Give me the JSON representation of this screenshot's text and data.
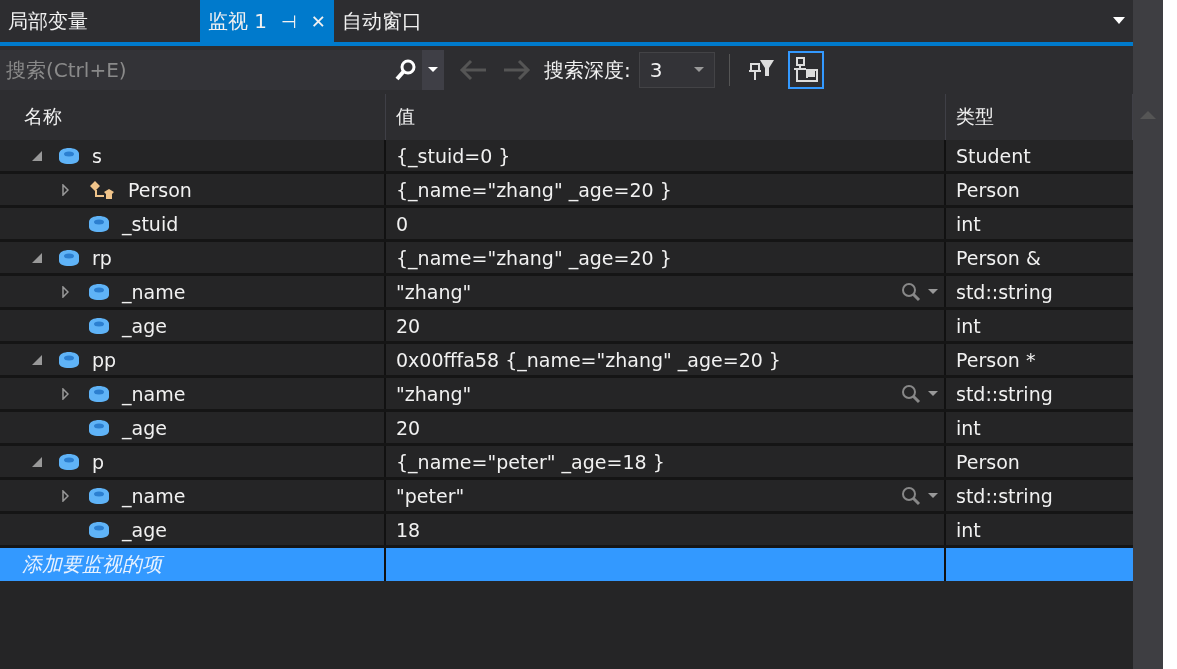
{
  "tabs": [
    {
      "label": "局部变量",
      "selected": false
    },
    {
      "label": "监视 1",
      "selected": true,
      "pin": "⊣",
      "close": "✕"
    },
    {
      "label": "自动窗口",
      "selected": false
    }
  ],
  "toolbar": {
    "search": {
      "placeholder": "搜索(Ctrl+E)"
    },
    "depth_label": "搜索深度:",
    "depth_value": "3",
    "filter_selected": false,
    "hex_selected": true
  },
  "columns": [
    "名称",
    "值",
    "类型"
  ],
  "variables": [
    {
      "name": "s",
      "kind": "field",
      "value": "{_stuid=0 }",
      "type": "Student",
      "expanded": true,
      "children": [
        {
          "name": "Person",
          "kind": "base",
          "value": "{_name=\"zhang\" _age=20 }",
          "type": "Person",
          "expanded": false
        },
        {
          "name": "_stuid",
          "kind": "field",
          "value": "0",
          "type": "int"
        }
      ]
    },
    {
      "name": "rp",
      "kind": "field",
      "value": "{_name=\"zhang\" _age=20 }",
      "type": "Person &",
      "expanded": true,
      "children": [
        {
          "name": "_name",
          "kind": "field",
          "value": "\"zhang\"",
          "type": "std::string",
          "expanded": false,
          "visualizer": true
        },
        {
          "name": "_age",
          "kind": "field",
          "value": "20",
          "type": "int"
        }
      ]
    },
    {
      "name": "pp",
      "kind": "field",
      "value": "0x00fffa58 {_name=\"zhang\" _age=20 }",
      "type": "Person *",
      "expanded": true,
      "children": [
        {
          "name": "_name",
          "kind": "field",
          "value": "\"zhang\"",
          "type": "std::string",
          "expanded": false,
          "visualizer": true
        },
        {
          "name": "_age",
          "kind": "field",
          "value": "20",
          "type": "int"
        }
      ]
    },
    {
      "name": "p",
      "kind": "field",
      "value": "{_name=\"peter\" _age=18 }",
      "type": "Person",
      "expanded": true,
      "children": [
        {
          "name": "_name",
          "kind": "field",
          "value": "\"peter\"",
          "type": "std::string",
          "expanded": false,
          "visualizer": true
        },
        {
          "name": "_age",
          "kind": "field",
          "value": "18",
          "type": "int"
        }
      ]
    }
  ],
  "add_item": {
    "placeholder": "添加要监视的项",
    "selected": true
  }
}
